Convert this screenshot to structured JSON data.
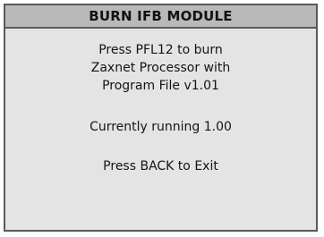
{
  "module": {
    "title": "BURN IFB MODULE",
    "instruction_lines": [
      "Press PFL12 to burn",
      "Zaxnet Processor with",
      "Program File v1.01"
    ],
    "status": "Currently running 1.00",
    "exit_hint": "Press BACK to Exit"
  }
}
